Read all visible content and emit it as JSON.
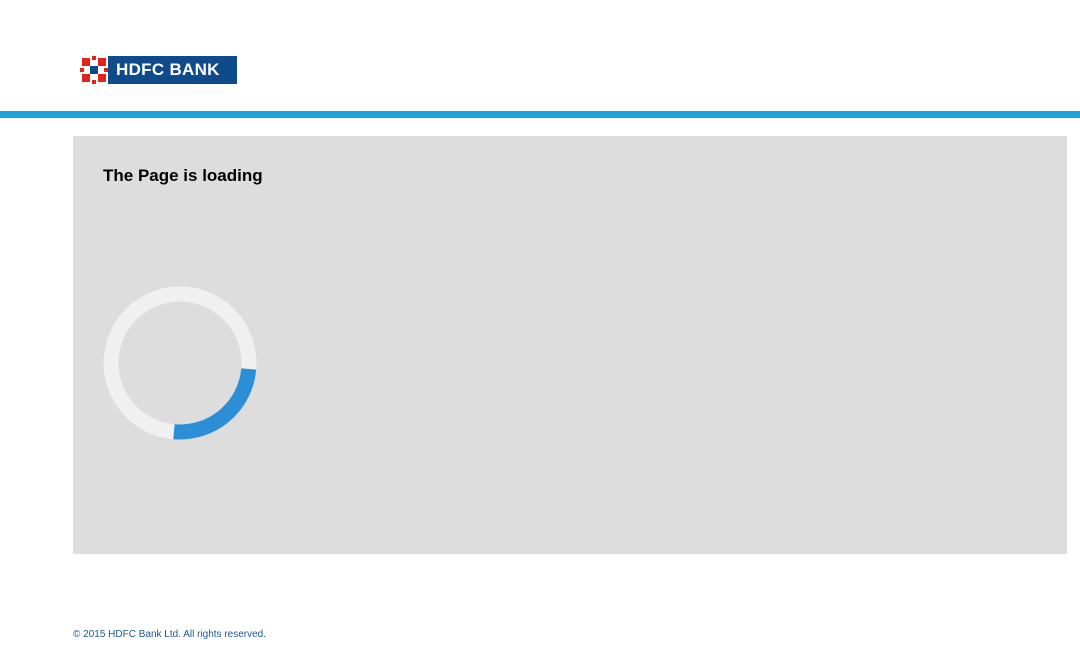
{
  "header": {
    "logo_text": "HDFC BANK",
    "logo_bg_color": "#0f4a8a",
    "logo_accent_color": "#e2231a",
    "bar_color": "#1aa3dd"
  },
  "main": {
    "title": "The Page is loading",
    "spinner": {
      "progress_fraction": 0.25,
      "track_color": "#f0f0f0",
      "arc_color": "#2b8ed6"
    }
  },
  "footer": {
    "copyright": "© 2015 HDFC Bank Ltd. All rights reserved."
  }
}
